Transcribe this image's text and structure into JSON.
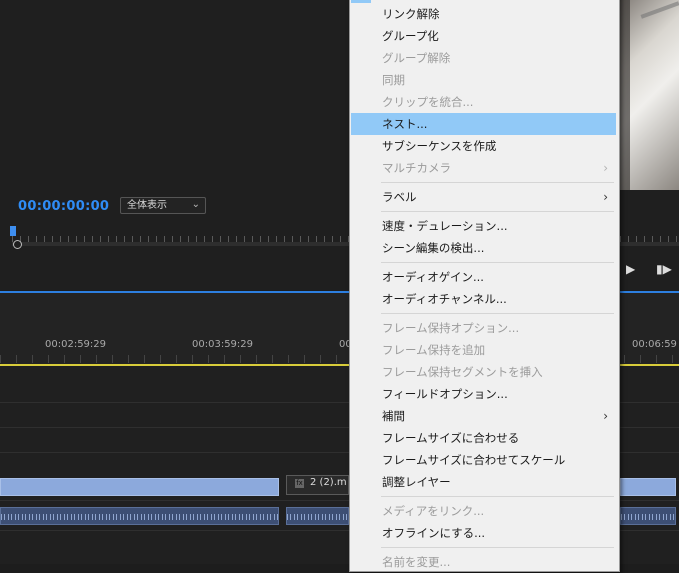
{
  "program_monitor": {
    "timecode": "00:00:00:00",
    "zoom_select": "全体表示"
  },
  "timeline": {
    "ruler_labels": [
      "00:02:59:29",
      "00:03:59:29",
      "00",
      "00:06:59"
    ],
    "clip_v2_label": "2 (2).m",
    "clip_v2_fx": "fx"
  },
  "context_menu": {
    "items": [
      {
        "label": "リンク解除",
        "enabled": true
      },
      {
        "label": "グループ化",
        "enabled": true
      },
      {
        "label": "グループ解除",
        "enabled": false
      },
      {
        "label": "同期",
        "enabled": false
      },
      {
        "label": "クリップを統合...",
        "enabled": false
      },
      {
        "label": "ネスト...",
        "enabled": true,
        "highlighted": true
      },
      {
        "label": "サブシーケンスを作成",
        "enabled": true
      },
      {
        "label": "マルチカメラ",
        "enabled": false,
        "submenu": true
      },
      {
        "label": "ラベル",
        "enabled": true,
        "submenu": true
      },
      {
        "label": "速度・デュレーション...",
        "enabled": true
      },
      {
        "label": "シーン編集の検出...",
        "enabled": true
      },
      {
        "label": "オーディオゲイン...",
        "enabled": true
      },
      {
        "label": "オーディオチャンネル...",
        "enabled": true
      },
      {
        "label": "フレーム保持オプション...",
        "enabled": false
      },
      {
        "label": "フレーム保持を追加",
        "enabled": false
      },
      {
        "label": "フレーム保持セグメントを挿入",
        "enabled": false
      },
      {
        "label": "フィールドオプション...",
        "enabled": true
      },
      {
        "label": "補間",
        "enabled": true,
        "submenu": true
      },
      {
        "label": "フレームサイズに合わせる",
        "enabled": true
      },
      {
        "label": "フレームサイズに合わせてスケール",
        "enabled": true
      },
      {
        "label": "調整レイヤー",
        "enabled": true
      },
      {
        "label": "メディアをリンク...",
        "enabled": false
      },
      {
        "label": "オフラインにする...",
        "enabled": true
      },
      {
        "label": "名前を変更...",
        "enabled": false
      }
    ],
    "submenu_arrow": "›"
  },
  "colors": {
    "timecode": "#2f8cf5",
    "menu_highlight": "#91c9f7",
    "work_area_bar": "#d8cc3a",
    "video_clip": "#8ca9dc",
    "audio_clip": "#3d4f74"
  },
  "icons": {
    "play": "play-icon",
    "step_forward": "step-forward-icon",
    "dropdown": "chevron-down-icon"
  }
}
